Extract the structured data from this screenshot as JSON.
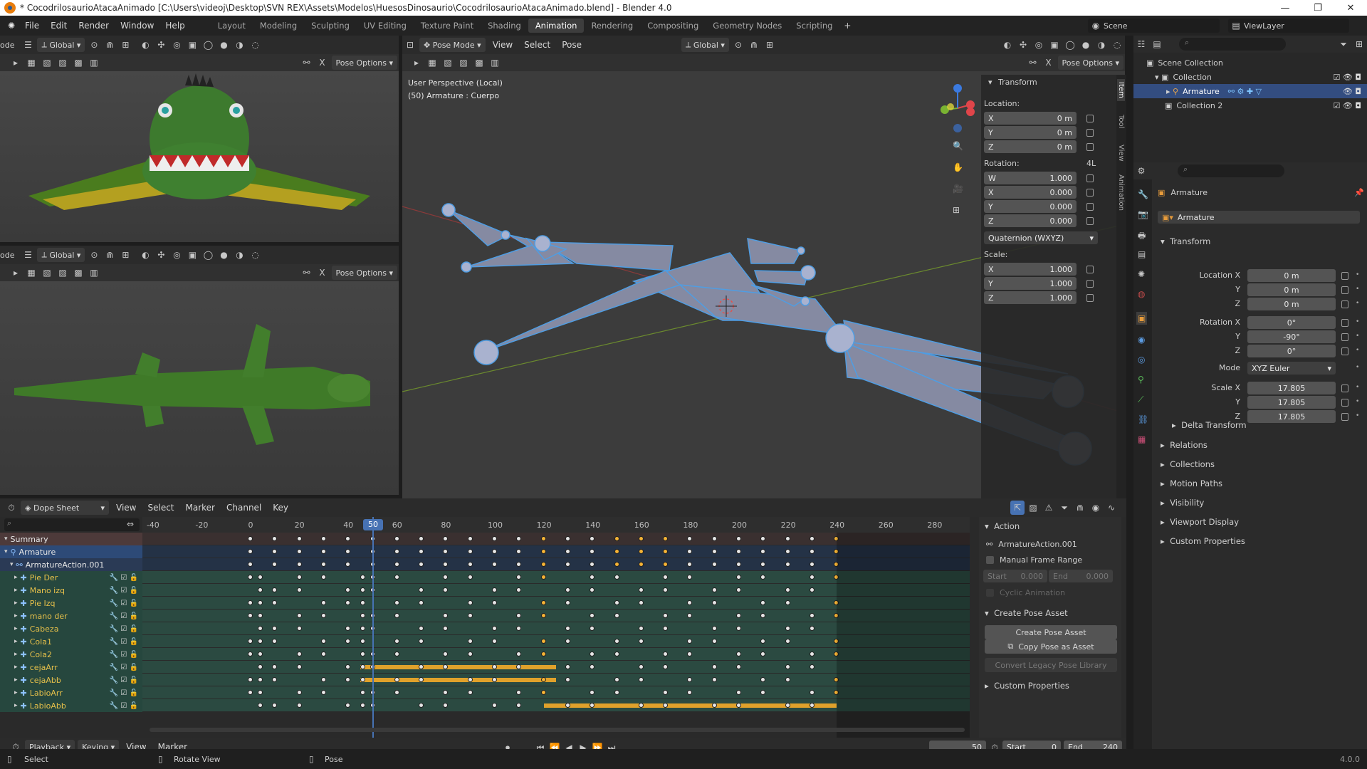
{
  "window": {
    "title": "* CocodrilosaurioAtacaAnimado [C:\\Users\\videoj\\Desktop\\SVN REX\\Assets\\Modelos\\HuesosDinosaurio\\CocodrilosaurioAtacaAnimado.blend] - Blender 4.0",
    "controls": [
      "—",
      "❐",
      "✕"
    ]
  },
  "menu": [
    "File",
    "Edit",
    "Render",
    "Window",
    "Help"
  ],
  "workspaces": [
    "Layout",
    "Modeling",
    "Sculpting",
    "UV Editing",
    "Texture Paint",
    "Shading",
    "Animation",
    "Rendering",
    "Compositing",
    "Geometry Nodes",
    "Scripting"
  ],
  "active_workspace": "Animation",
  "scene": {
    "label": "Scene",
    "layer": "ViewLayer"
  },
  "viewports": {
    "mode_cut": "ode",
    "global": "Global",
    "pose_options": "Pose Options",
    "pose_mode": "Pose Mode",
    "view": "View",
    "select": "Select",
    "pose": "Pose",
    "overlay_line1": "User Perspective (Local)",
    "overlay_line2": "(50) Armature : Cuerpo"
  },
  "npanel": {
    "tabs": [
      "Item",
      "Tool",
      "View",
      "Animation"
    ],
    "header": "Transform",
    "location_label": "Location:",
    "location": [
      {
        "a": "X",
        "v": "0 m"
      },
      {
        "a": "Y",
        "v": "0 m"
      },
      {
        "a": "Z",
        "v": "0 m"
      }
    ],
    "rotation_label": "Rotation:",
    "rotation_tag": "4L",
    "rotation": [
      {
        "a": "W",
        "v": "1.000"
      },
      {
        "a": "X",
        "v": "0.000"
      },
      {
        "a": "Y",
        "v": "0.000"
      },
      {
        "a": "Z",
        "v": "0.000"
      }
    ],
    "rotation_mode": "Quaternion (WXYZ)",
    "scale_label": "Scale:",
    "scale": [
      {
        "a": "X",
        "v": "1.000"
      },
      {
        "a": "Y",
        "v": "1.000"
      },
      {
        "a": "Z",
        "v": "1.000"
      }
    ]
  },
  "outliner": {
    "root": "Scene Collection",
    "items": [
      {
        "label": "Collection"
      },
      {
        "label": "Armature"
      },
      {
        "label": "Collection 2"
      }
    ]
  },
  "properties": {
    "object": "Armature",
    "data": "Armature",
    "transform_header": "Transform",
    "rows": [
      {
        "label": "Location X",
        "value": "0 m"
      },
      {
        "label": "Y",
        "value": "0 m"
      },
      {
        "label": "Z",
        "value": "0 m"
      },
      {
        "label": "Rotation X",
        "value": "0°"
      },
      {
        "label": "Y",
        "value": "-90°"
      },
      {
        "label": "Z",
        "value": "0°"
      },
      {
        "label": "Mode",
        "value": "XYZ Euler"
      },
      {
        "label": "Scale X",
        "value": "17.805"
      },
      {
        "label": "Y",
        "value": "17.805"
      },
      {
        "label": "Z",
        "value": "17.805"
      }
    ],
    "delta": "Delta Transform",
    "sections": [
      "Relations",
      "Collections",
      "Motion Paths",
      "Visibility",
      "Viewport Display",
      "Custom Properties"
    ]
  },
  "dope": {
    "editor": "Dope Sheet",
    "menus": [
      "View",
      "Select",
      "Marker",
      "Channel",
      "Key"
    ],
    "ruler": [
      "-40",
      "-20",
      "0",
      "20",
      "40",
      "60",
      "80",
      "100",
      "120",
      "140",
      "160",
      "180",
      "200",
      "220",
      "240",
      "260",
      "280"
    ],
    "current_frame": "50",
    "channels": [
      "Summary",
      "Armature",
      "ArmatureAction.001",
      "Pie Der",
      "Mano izq",
      "Pie Izq",
      "mano der",
      "Cabeza",
      "Cola1",
      "Cola2",
      "cejaArr",
      "cejaAbb",
      "LabioArr",
      "LabioAbb"
    ],
    "action_panel": {
      "header": "Action",
      "action_name": "ArmatureAction.001",
      "manual_range": "Manual Frame Range",
      "start_label": "Start",
      "start_val": "0.000",
      "end_label": "End",
      "end_val": "0.000",
      "cyclic": "Cyclic Animation",
      "pose_header": "Create Pose Asset",
      "create_btn": "Create Pose Asset",
      "copy_btn": "Copy Pose as Asset",
      "convert_btn": "Convert Legacy Pose Library",
      "custom": "Custom Properties"
    }
  },
  "timeline": {
    "playback": "Playback",
    "keying": "Keying",
    "view": "View",
    "marker": "Marker",
    "frame": "50",
    "start_label": "Start",
    "start": "0",
    "end_label": "End",
    "end": "240"
  },
  "status": {
    "select": "Select",
    "rotate": "Rotate View",
    "pose": "Pose",
    "version": "4.0.0"
  },
  "colors": {
    "accent": "#4772b3",
    "key_selected": "#f5b335",
    "bone": "#8c93ab",
    "active_tab": "#3d3d3d"
  }
}
